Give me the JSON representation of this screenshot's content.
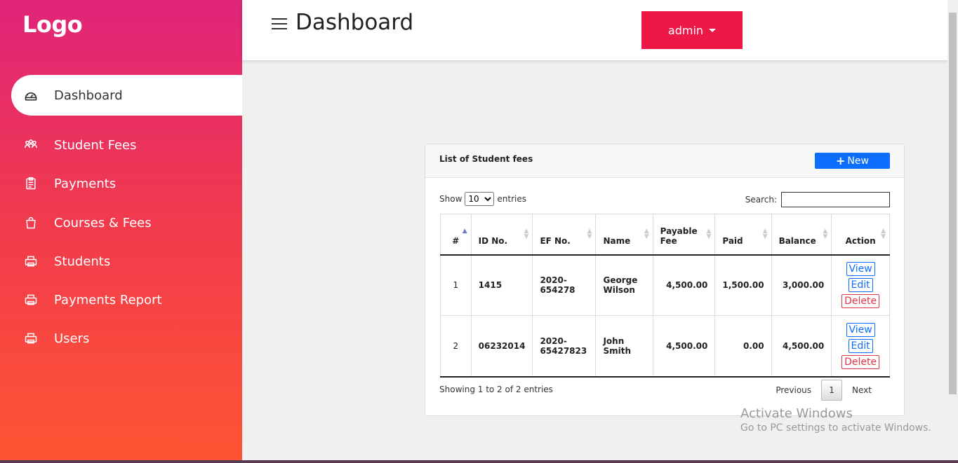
{
  "sidebar": {
    "logo": "Logo",
    "items": [
      {
        "label": "Dashboard",
        "icon": "dashboard-icon"
      },
      {
        "label": "Student Fees",
        "icon": "users-icon"
      },
      {
        "label": "Payments",
        "icon": "clipboard-icon"
      },
      {
        "label": "Courses & Fees",
        "icon": "shopping-bag-icon"
      },
      {
        "label": "Students",
        "icon": "printer-icon"
      },
      {
        "label": "Payments Report",
        "icon": "printer-icon"
      },
      {
        "label": "Users",
        "icon": "printer-icon"
      }
    ]
  },
  "header": {
    "title": "Dashboard",
    "user_button": "admin"
  },
  "card": {
    "title": "List of Student fees",
    "new_button": "New",
    "show_label": "Show",
    "entries_label": "entries",
    "entries_value": "10",
    "search_label": "Search:",
    "columns": [
      "#",
      "ID No.",
      "EF No.",
      "Name",
      "Payable Fee",
      "Paid",
      "Balance",
      "Action"
    ],
    "rows": [
      {
        "num": "1",
        "id": "1415",
        "ef": "2020-654278",
        "name": "George Wilson",
        "payable": "4,500.00",
        "paid": "1,500.00",
        "balance": "3,000.00"
      },
      {
        "num": "2",
        "id": "06232014",
        "ef": "2020-65427823",
        "name": "John Smith",
        "payable": "4,500.00",
        "paid": "0.00",
        "balance": "4,500.00"
      }
    ],
    "actions": {
      "view": "View",
      "edit": "Edit",
      "delete": "Delete"
    },
    "footer_info": "Showing 1 to 2 of 2 entries",
    "pagination": {
      "previous": "Previous",
      "current": "1",
      "next": "Next"
    }
  },
  "watermark": {
    "line1": "Activate Windows",
    "line2": "Go to PC settings to activate Windows."
  },
  "colors": {
    "sidebar_top": "#e0247a",
    "sidebar_bottom": "#ff5533",
    "admin_button": "#ee1847",
    "new_button": "#0d6efd",
    "delete_button": "#dc3545"
  }
}
